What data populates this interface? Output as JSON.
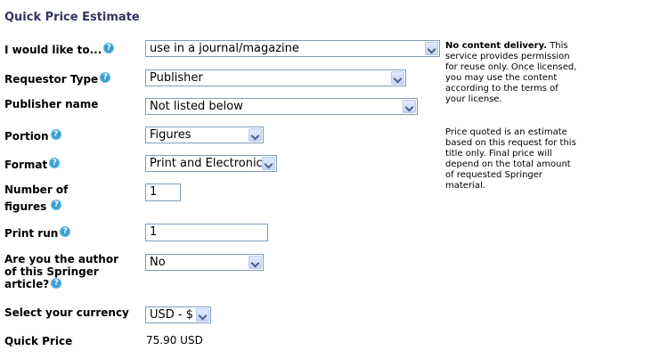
{
  "page_title": "Quick Price Estimate",
  "help_glyph": "?",
  "fields": {
    "use": {
      "label": "I would like to...",
      "value": "use in a journal/magazine"
    },
    "requestor": {
      "label": "Requestor Type",
      "value": "Publisher"
    },
    "publisher": {
      "label": "Publisher name",
      "value": "Not listed below"
    },
    "portion": {
      "label": "Portion",
      "value": "Figures"
    },
    "format": {
      "label": "Format",
      "value": "Print and Electronic"
    },
    "num_figures": {
      "label_line1": "Number of",
      "label_line2": "figures",
      "value": "1"
    },
    "print_run": {
      "label": "Print run",
      "value": "1"
    },
    "author": {
      "label_line1": "Are you the author",
      "label_line2": "of this Springer",
      "label_line3": "article?",
      "value": "No"
    },
    "currency": {
      "label": "Select your currency",
      "value": "USD - $"
    },
    "quick_price": {
      "label": "Quick Price",
      "value": "75.90 USD"
    }
  },
  "notes": {
    "delivery_heading": "No content delivery.",
    "delivery_text": "This service provides permission for reuse only. Once licensed, you may use the content according to the terms of your license.",
    "price_text": "Price quoted is an estimate based on this request for this title only. Final price will depend on the total amount of requested Springer material."
  }
}
